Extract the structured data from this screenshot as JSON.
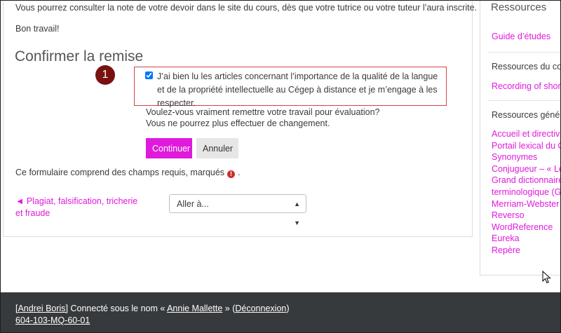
{
  "main": {
    "intro_text": "Vous pourrez consulter la note de votre devoir dans le site du cours, dès que votre tutrice ou votre tuteur l’aura inscrite.",
    "good_luck": "Bon travail!",
    "section_title": "Confirmer la remise",
    "step_marker": "1",
    "confirm_checkbox_checked": true,
    "confirm_text": "J’ai bien lu les articles concernant l’importance de la qualité de la langue et de la propriété intellectuelle au Cégep à distance et je m’engage à les respecter.",
    "question": "Voulez-vous vraiment remettre votre travail pour évaluation?",
    "warning": "Vous ne pourrez plus effectuer de changement.",
    "continue_label": "Continuer",
    "cancel_label": "Annuler",
    "required_note_before": "Ce formulaire comprend des champs requis, marqués",
    "required_note_after": ".",
    "prev_link": "◄ Plagiat, falsification, tricherie et fraude",
    "jump_select": "Aller à..."
  },
  "sidebar": {
    "title": "Ressources",
    "study_guide": "Guide d’études",
    "course_resources_heading": "Ressources du cours",
    "course_resource_link": "Recording of short p",
    "general_resources_heading": "Ressources générale",
    "general_links": [
      "Accueil et directives",
      "Portail lexical du CN",
      "Synonymes",
      "Conjugueur – « Le P",
      "Grand dictionnaire",
      "terminologique (GD",
      "Merriam-Webster",
      "Reverso",
      "WordReference",
      "Eureka",
      "Repère"
    ]
  },
  "footer": {
    "user_link": "[Andrei Boris]",
    "connected_as": " Connecté sous le nom « ",
    "user_name": "Annie Mallette",
    "between": " » (",
    "logout": "Déconnexion",
    "close_paren": ")",
    "course_code": "604-103-MQ-60-01"
  },
  "colors": {
    "accent": "#e01adc",
    "marker": "#7a1111",
    "footer_bg": "#373a3c",
    "highlight_border": "#d24545"
  }
}
